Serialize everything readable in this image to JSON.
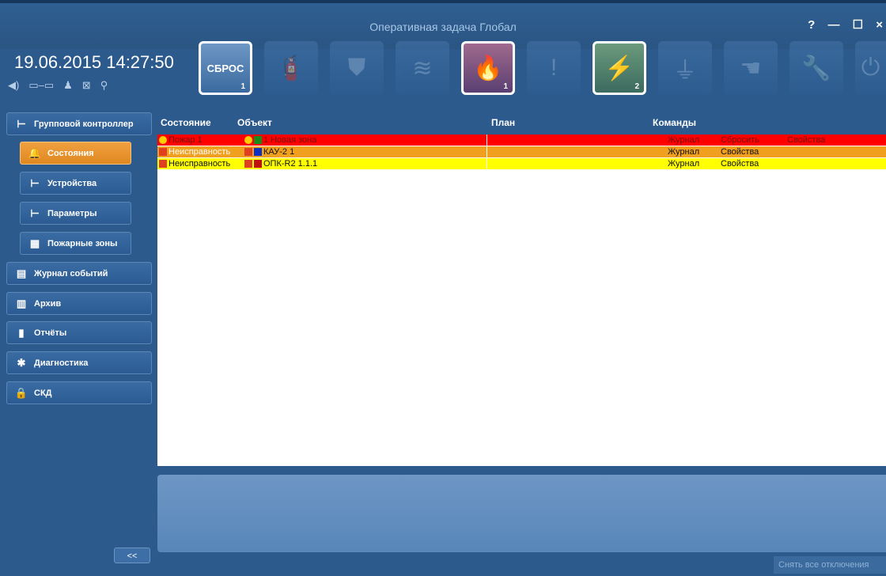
{
  "window": {
    "title": "Оперативная задача Глобал",
    "controls": "? — ☐ ×"
  },
  "datetime": "19.06.2015 14:27:50",
  "status_icons": [
    "sound-icon",
    "network-icon",
    "user-icon",
    "close-box-icon",
    "location-off-icon"
  ],
  "toolbar": {
    "reset_label": "СБРОС",
    "reset_count": "1",
    "fire_count": "1",
    "power_count": "2"
  },
  "sidebar": {
    "items": [
      {
        "label": "Групповой контроллер"
      },
      {
        "label": "Состояния"
      },
      {
        "label": "Устройства"
      },
      {
        "label": "Параметры"
      },
      {
        "label": "Пожарные зоны"
      },
      {
        "label": "Журнал событий"
      },
      {
        "label": "Архив"
      },
      {
        "label": "Отчёты"
      },
      {
        "label": "Диагностика"
      },
      {
        "label": "СКД"
      }
    ],
    "collapse_label": "<<"
  },
  "table": {
    "headers": [
      "Состояние",
      "Объект",
      "План",
      "Команды"
    ],
    "rows": [
      {
        "state": "Пожар 1",
        "object": "1 Новая зона",
        "cmd1": "Журнал",
        "cmd2": "Сбросить",
        "cmd3": "Свойства"
      },
      {
        "state": "Неисправность",
        "object": "КАУ-2 1",
        "cmd1": "Журнал",
        "cmd2": "Свойства",
        "cmd3": ""
      },
      {
        "state": "Неисправность",
        "object": "ОПК-R2 1.1.1",
        "cmd1": "Журнал",
        "cmd2": "Свойства",
        "cmd3": ""
      }
    ]
  },
  "footer": {
    "clear_all": "Снять все отключения"
  },
  "colors": {
    "fire_row": "#fe0000",
    "fault_row": "#f0a01e",
    "warning_row": "#ffff00",
    "selected_nav": "#f0a040"
  }
}
